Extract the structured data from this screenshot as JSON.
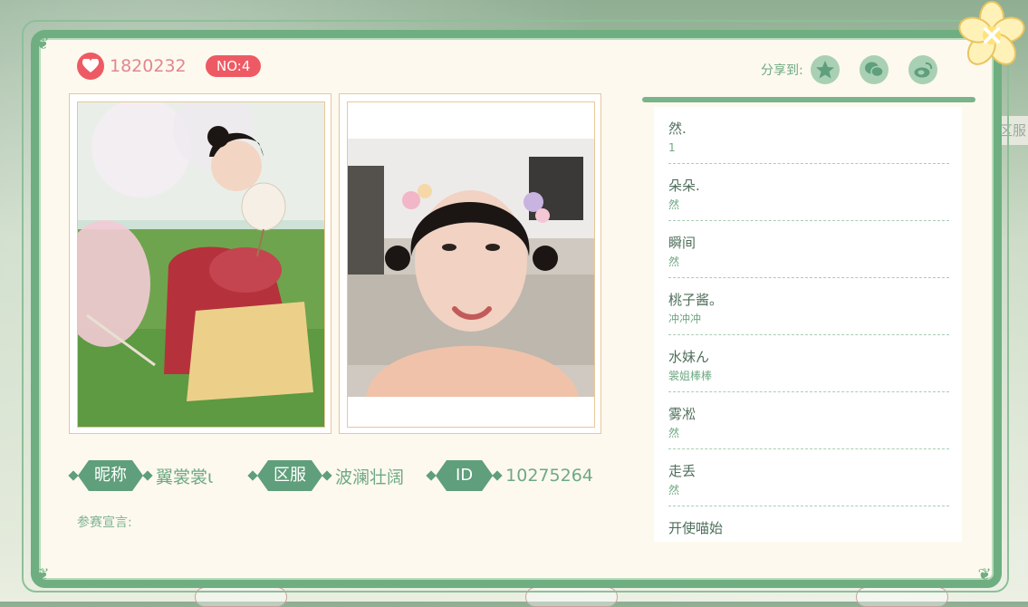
{
  "background": {
    "side_label": "区服"
  },
  "header": {
    "likes": "1820232",
    "rank": "NO:4",
    "share_label": "分享到:",
    "share_targets": [
      "qzone-icon",
      "wechat-icon",
      "weibo-icon"
    ]
  },
  "profile": {
    "nickname_label": "昵称",
    "nickname_value": "翼裳裳ι",
    "server_label": "区服",
    "server_value": "波澜壮阔",
    "id_label": "ID",
    "id_value": "10275264",
    "declaration_label": "参赛宣言:"
  },
  "messages": [
    {
      "name": "然.",
      "text": "1"
    },
    {
      "name": "朵朵.",
      "text": "然"
    },
    {
      "name": "瞬间",
      "text": "然"
    },
    {
      "name": "桃子酱。",
      "text": "冲冲冲"
    },
    {
      "name": "水妹ん",
      "text": "裳姐棒棒"
    },
    {
      "name": "雾凇",
      "text": "然"
    },
    {
      "name": "走丢",
      "text": "然"
    },
    {
      "name": "开使喵始",
      "text": ""
    }
  ],
  "colors": {
    "accent": "#6fae80",
    "heart": "#ee5a63",
    "panel": "#fdf9ef"
  }
}
